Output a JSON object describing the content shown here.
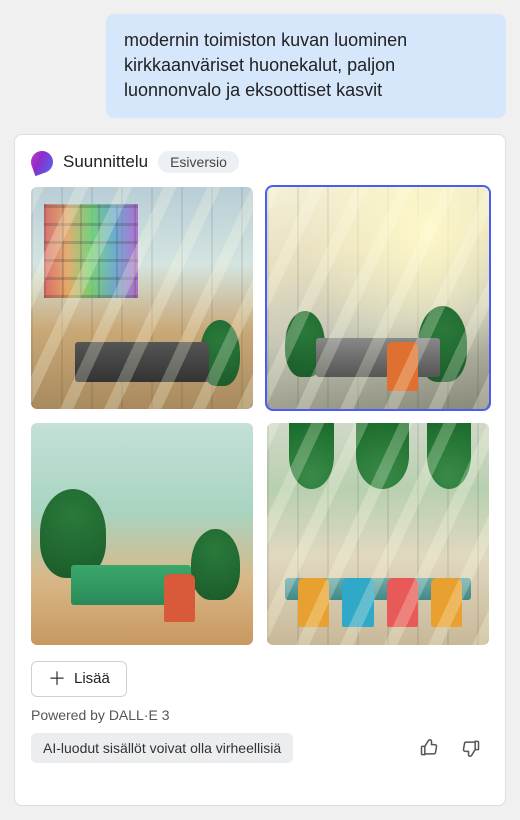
{
  "chat": {
    "user_message": "modernin toimiston kuvan luominen kirkkaanväriset huonekalut, paljon luonnonvalo ja eksoottiset kasvit"
  },
  "card": {
    "app_name": "Suunnittelu",
    "badge": "Esiversio",
    "images": {
      "selected_index": 1,
      "items": [
        {
          "alt": "modern-office-colorful-shelves"
        },
        {
          "alt": "modern-office-sunlit-plants"
        },
        {
          "alt": "modern-office-green-desk"
        },
        {
          "alt": "modern-office-large-hall-chairs"
        }
      ]
    },
    "add_button": "Lisää",
    "powered_by": "Powered by DALL·E 3",
    "disclaimer": "AI-luodut sisällöt voivat olla virheellisiä"
  }
}
